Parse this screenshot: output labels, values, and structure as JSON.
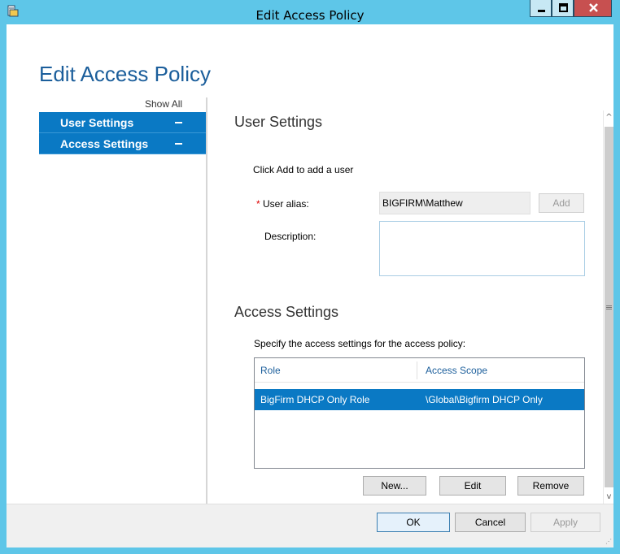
{
  "window": {
    "title": "Edit Access Policy",
    "icon": "policy-icon",
    "accent_color": "#5ec6e8",
    "close_color": "#c75050"
  },
  "page": {
    "title": "Edit Access Policy"
  },
  "nav": {
    "show_all": "Show All",
    "items": [
      {
        "label": "User Settings",
        "icon": "collapse-minus-icon"
      },
      {
        "label": "Access Settings",
        "icon": "collapse-minus-icon"
      }
    ],
    "selected_color": "#0a79c4"
  },
  "user_settings": {
    "title": "User Settings",
    "hint": "Click Add to add a user",
    "alias_required_marker": "*",
    "alias_label": "User alias:",
    "alias_value": "BIGFIRM\\Matthew",
    "add_button": "Add",
    "description_label": "Description:",
    "description_value": ""
  },
  "access_settings": {
    "title": "Access Settings",
    "hint": "Specify the access settings for the access policy:",
    "columns": [
      "Role",
      "Access Scope"
    ],
    "rows": [
      {
        "role": "BigFirm DHCP Only Role",
        "scope": "\\Global\\Bigfirm DHCP Only"
      }
    ],
    "buttons": {
      "new": "New...",
      "edit": "Edit",
      "remove": "Remove"
    }
  },
  "footer": {
    "ok": "OK",
    "cancel": "Cancel",
    "apply": "Apply"
  }
}
